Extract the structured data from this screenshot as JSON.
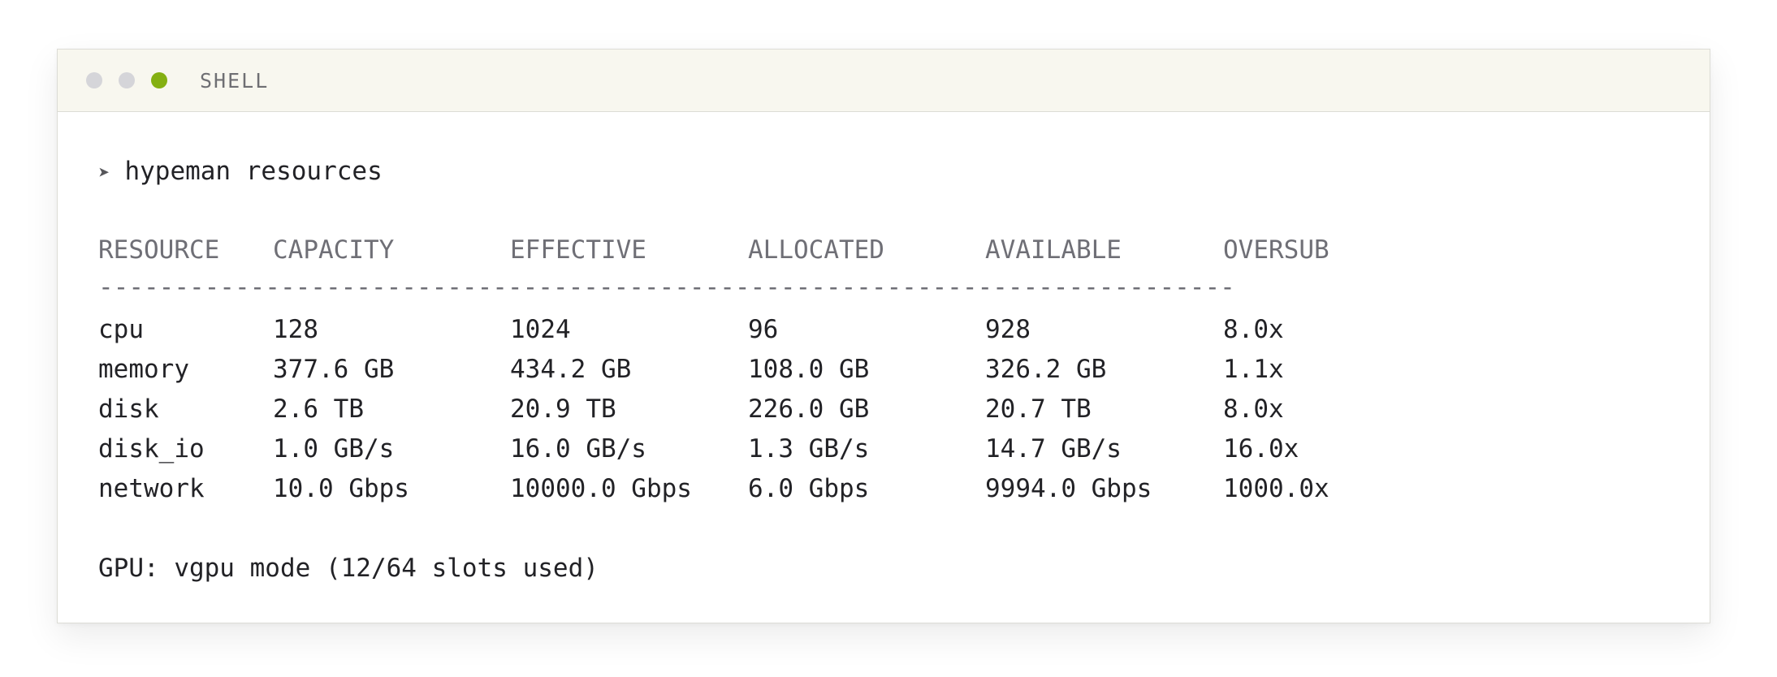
{
  "window": {
    "title": "SHELL",
    "dots": [
      {
        "name": "dot-1",
        "color": "#d5d5d9"
      },
      {
        "name": "dot-2",
        "color": "#d5d5d9"
      },
      {
        "name": "dot-3",
        "color": "#84b012"
      }
    ]
  },
  "terminal": {
    "prompt_symbol": "➤",
    "command": "hypeman resources",
    "headers": [
      "RESOURCE",
      "CAPACITY",
      "EFFECTIVE",
      "ALLOCATED",
      "AVAILABLE",
      "OVERSUB"
    ],
    "separator": "---------------------------------------------------------------------------",
    "rows": [
      [
        "cpu",
        "128",
        "1024",
        "96",
        "928",
        "8.0x"
      ],
      [
        "memory",
        "377.6 GB",
        "434.2 GB",
        "108.0 GB",
        "326.2 GB",
        "1.1x"
      ],
      [
        "disk",
        "2.6 TB",
        "20.9 TB",
        "226.0 GB",
        "20.7 TB",
        "8.0x"
      ],
      [
        "disk_io",
        "1.0 GB/s",
        "16.0 GB/s",
        "1.3 GB/s",
        "14.7 GB/s",
        "16.0x"
      ],
      [
        "network",
        "10.0 Gbps",
        "10000.0 Gbps",
        "6.0 Gbps",
        "9994.0 Gbps",
        "1000.0x"
      ]
    ],
    "gpu_line": "GPU: vgpu mode (12/64 slots used)"
  }
}
